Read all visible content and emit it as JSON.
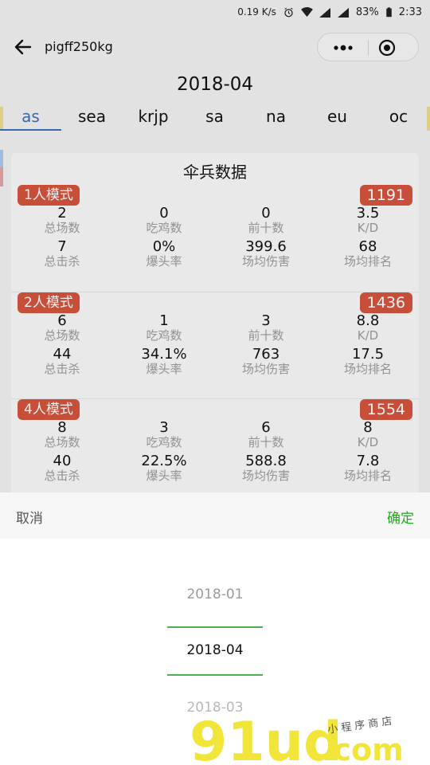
{
  "status_bar": {
    "net_speed": "0.19 K/s",
    "battery": "83%",
    "time": "2:33"
  },
  "nav": {
    "title": "pigff250kg",
    "back_icon": "arrow-left-icon",
    "more_icon": "more-dots-icon",
    "close_icon": "target-icon"
  },
  "month": "2018-04",
  "regions": [
    "as",
    "sea",
    "krjp",
    "sa",
    "na",
    "eu",
    "oc"
  ],
  "active_region": "as",
  "card_title": "伞兵数据",
  "modes": [
    {
      "label": "1人模式",
      "rating": "1191",
      "stats": [
        {
          "value": "2",
          "label": "总场数"
        },
        {
          "value": "0",
          "label": "吃鸡数"
        },
        {
          "value": "0",
          "label": "前十数"
        },
        {
          "value": "3.5",
          "label": "K/D"
        },
        {
          "value": "7",
          "label": "总击杀"
        },
        {
          "value": "0%",
          "label": "爆头率"
        },
        {
          "value": "399.6",
          "label": "场均伤害"
        },
        {
          "value": "68",
          "label": "场均排名"
        }
      ]
    },
    {
      "label": "2人模式",
      "rating": "1436",
      "stats": [
        {
          "value": "6",
          "label": "总场数"
        },
        {
          "value": "1",
          "label": "吃鸡数"
        },
        {
          "value": "3",
          "label": "前十数"
        },
        {
          "value": "8.8",
          "label": "K/D"
        },
        {
          "value": "44",
          "label": "总击杀"
        },
        {
          "value": "34.1%",
          "label": "爆头率"
        },
        {
          "value": "763",
          "label": "场均伤害"
        },
        {
          "value": "17.5",
          "label": "场均排名"
        }
      ]
    },
    {
      "label": "4人模式",
      "rating": "1554",
      "stats": [
        {
          "value": "8",
          "label": "总场数"
        },
        {
          "value": "3",
          "label": "吃鸡数"
        },
        {
          "value": "6",
          "label": "前十数"
        },
        {
          "value": "8",
          "label": "K/D"
        },
        {
          "value": "40",
          "label": "总击杀"
        },
        {
          "value": "22.5%",
          "label": "爆头率"
        },
        {
          "value": "588.8",
          "label": "场均伤害"
        },
        {
          "value": "7.8",
          "label": "场均排名"
        }
      ]
    }
  ],
  "picker": {
    "cancel_label": "取消",
    "confirm_label": "确定",
    "options": [
      "2018-01",
      "2018-04",
      "2018-03"
    ],
    "selected": "2018-04"
  },
  "watermark": {
    "brand": "91ud",
    "domain": ".com",
    "tagline": "小 程 序 商 店"
  },
  "colors": {
    "badge": "#d2543e",
    "active_tab": "#3a6fb0",
    "confirm": "#1aad19",
    "selection_line": "#4caf50"
  }
}
